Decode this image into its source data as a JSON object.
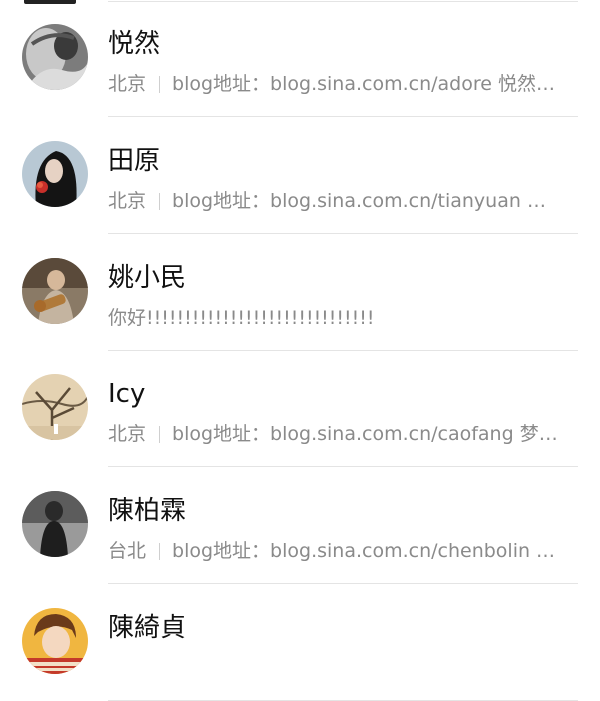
{
  "contacts": [
    {
      "name": "悦然",
      "location": "北京",
      "description": "blog地址：blog.sina.com.cn/adore 悦然…",
      "avatar_icon": "avatar-photo-icon"
    },
    {
      "name": "田原",
      "location": "北京",
      "description": "blog地址：blog.sina.com.cn/tianyuan …",
      "avatar_icon": "avatar-photo-icon"
    },
    {
      "name": "姚小民",
      "status": "你好!!!!!!!!!!!!!!!!!!!!!!!!!!!!!!",
      "avatar_icon": "avatar-photo-icon"
    },
    {
      "name": "Icy",
      "location": "北京",
      "description": "blog地址：blog.sina.com.cn/caofang 梦…",
      "avatar_icon": "avatar-photo-icon"
    },
    {
      "name": "陳柏霖",
      "location": "台北",
      "description": "blog地址：blog.sina.com.cn/chenbolin …",
      "avatar_icon": "avatar-photo-icon"
    },
    {
      "name": "陳綺貞",
      "avatar_icon": "avatar-photo-icon"
    }
  ]
}
